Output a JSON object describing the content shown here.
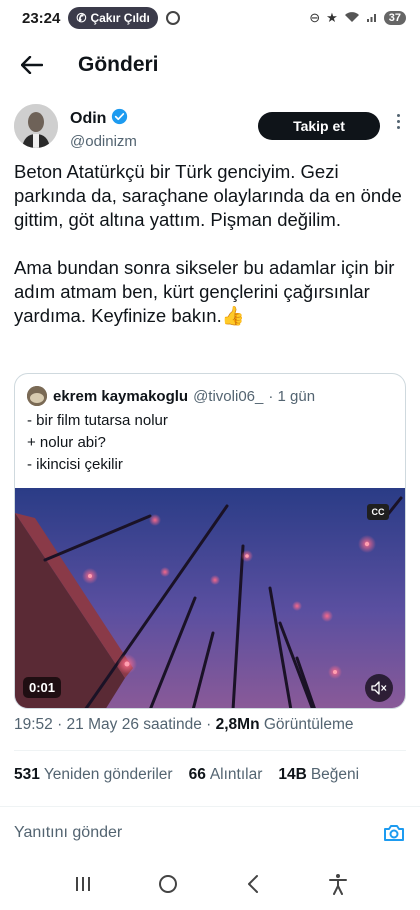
{
  "status_bar": {
    "time": "23:24",
    "call_label": "Çakır Çıldı",
    "battery": "37"
  },
  "header": {
    "title": "Gönderi"
  },
  "post": {
    "author_name": "Odin",
    "author_handle": "@odinizm",
    "follow_label": "Takip et",
    "text": "Beton Atatürkçü bir Türk genciyim. Gezi parkında da, saraçhane olaylarında da en önde gittim, göt altına yattım. Pişman değilim.\n\nAma bundan sonra sikseler bu adamlar için bir adım atmam ben, kürt gençlerini çağırsınlar yardıma. Keyfinize bakın.👍"
  },
  "quote": {
    "name": "ekrem kaymakoglu",
    "handle": "@tivoli06_",
    "age": "· 1 gün",
    "text": "- bir film tutarsa nolur\n+ nolur abi?\n- ikincisi çekilir",
    "video": {
      "duration": "0:01",
      "cc_label": "CC"
    }
  },
  "meta": {
    "time_date": "19:52 · 21 May 26 saatinde · ",
    "views_count": "2,8Mn",
    "views_label": "Görüntüleme"
  },
  "stats": [
    {
      "count": "531",
      "label": "Yeniden gönderiler"
    },
    {
      "count": "66",
      "label": "Alıntılar"
    },
    {
      "count": "14B",
      "label": "Beğeni"
    }
  ],
  "reply": {
    "placeholder": "Yanıtını gönder"
  },
  "colors": {
    "accent": "#1d9bf0",
    "text": "#0f1419",
    "muted": "#536471"
  }
}
